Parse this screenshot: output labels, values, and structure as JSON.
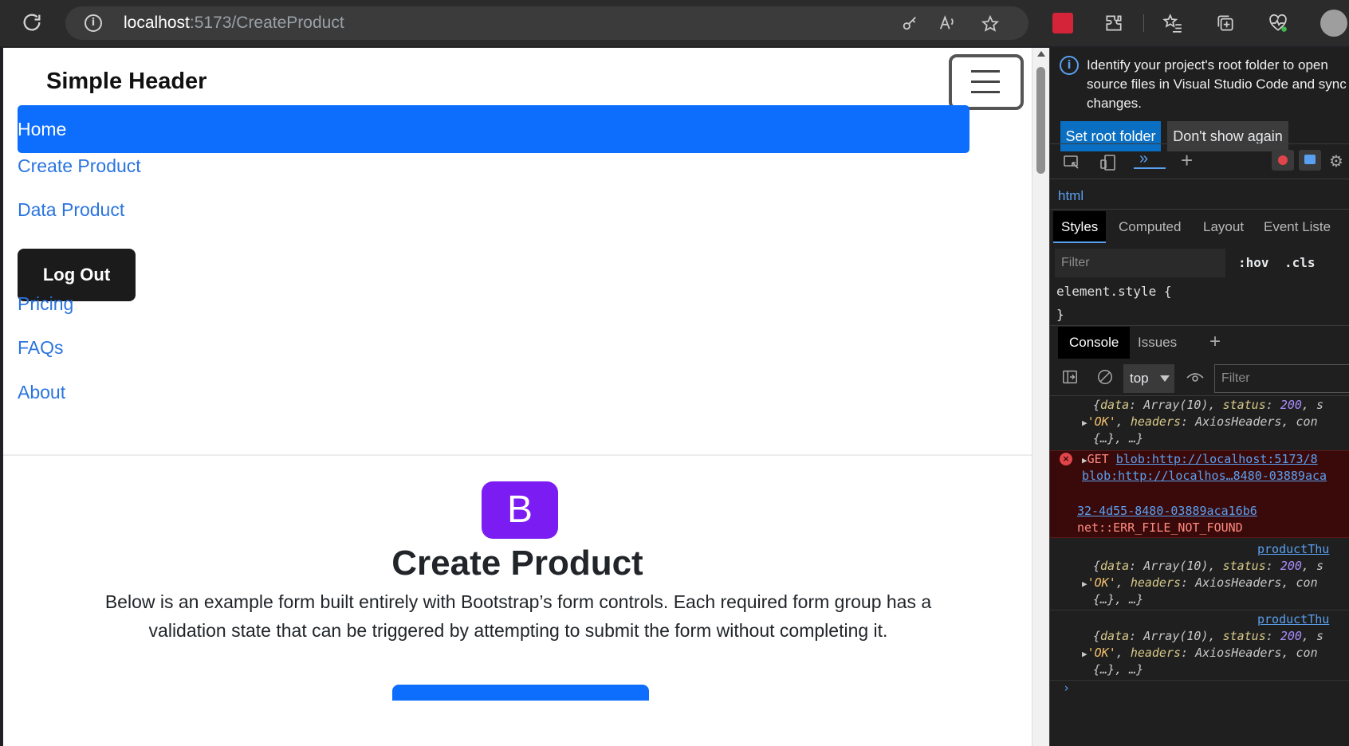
{
  "browser": {
    "url_host": "localhost",
    "url_path": ":5173/CreateProduct"
  },
  "header": {
    "brand": "Simple Header"
  },
  "nav": {
    "home": "Home",
    "create_product": "Create Product",
    "data_product": "Data Product",
    "logout": "Log Out",
    "pricing": "Pricing",
    "faqs": "FAQs",
    "about": "About"
  },
  "hero": {
    "logo_letter": "B",
    "title": "Create Product",
    "text": "Below is an example form built entirely with Bootstrap’s form controls. Each required form group has a validation state that can be triggered by attempting to submit the form without completing it."
  },
  "devtools": {
    "infobar_text": "Identify your project's root folder to open source files in Visual Studio Code and sync changes.",
    "set_root_label": "Set root folder",
    "dont_show_label": "Don't show again",
    "breadcrumb": "html",
    "tabs": [
      "Styles",
      "Computed",
      "Layout",
      "Event Liste"
    ],
    "filter_placeholder": "Filter",
    "hov": ":hov",
    "cls": ".cls",
    "element_style": "element.style {",
    "close_brace": "}",
    "console_tabs": [
      "Console",
      "Issues"
    ],
    "context": "top",
    "console_filter": "Filter",
    "logs": {
      "l1a_key": "data",
      "l1a_val": "Array(10)",
      "l1a_key2": "status",
      "l1a_num": "200",
      "l1a_tail": "s",
      "l1b_str": "'OK'",
      "l1b_key": "headers",
      "l1b_val": "AxiosHeaders",
      "l1b_tail": "con",
      "l1c": "{…}, …}",
      "err_method": "GET",
      "err_url": "blob:http://localhost:5173/8",
      "err_url2": "blob:http://localhos…8480-03889aca",
      "err_url3": "32-4d55-8480-03889aca16b6",
      "err_msg": "net::ERR_FILE_NOT_FOUND",
      "source": "productThu",
      "source2": "productThu"
    }
  }
}
